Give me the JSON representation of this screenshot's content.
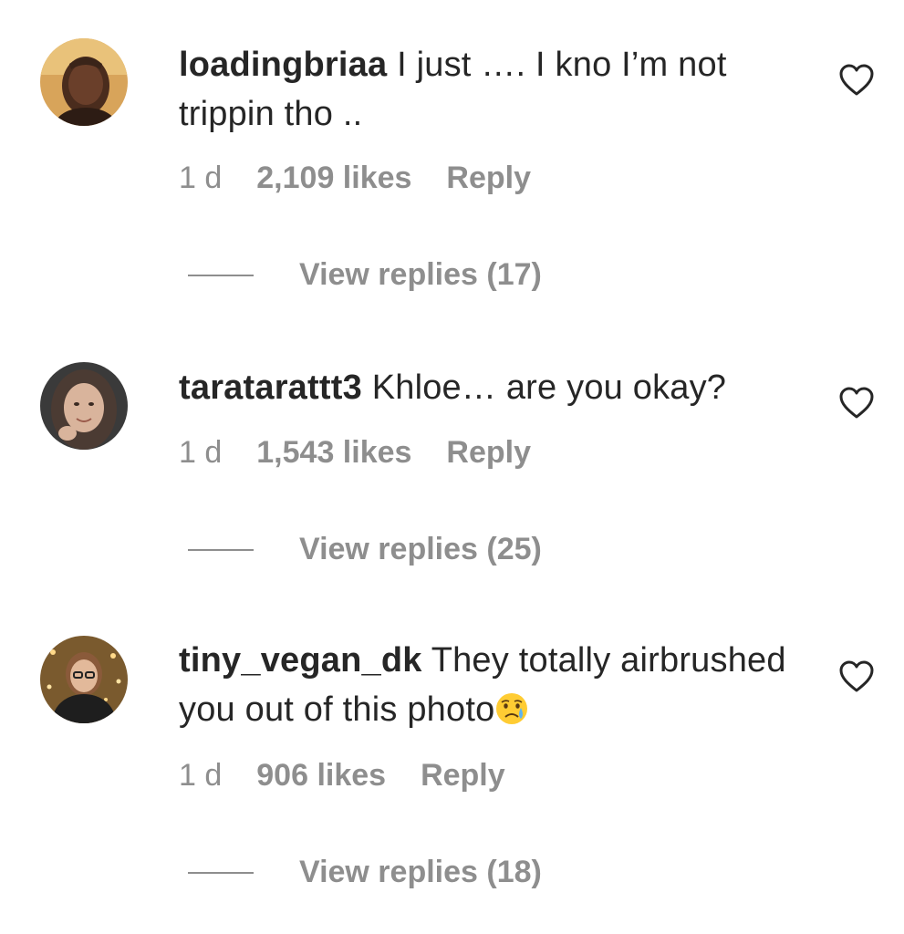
{
  "comments": [
    {
      "username": "loadingbriaa",
      "text": "I just …. I kno I’m not trippin tho ..",
      "time": "1 d",
      "likes": "2,109 likes",
      "reply_label": "Reply",
      "view_replies": "View replies (17)",
      "icon": "heart-outline-icon"
    },
    {
      "username": "taratarattt3",
      "text": "Khloe… are you okay?",
      "time": "1 d",
      "likes": "1,543 likes",
      "reply_label": "Reply",
      "view_replies": "View replies (25)",
      "icon": "heart-outline-icon"
    },
    {
      "username": "tiny_vegan_dk",
      "text": "They totally airbrushed you out of this photo",
      "emoji": "crying-face-emoji",
      "time": "1 d",
      "likes": "906 likes",
      "reply_label": "Reply",
      "view_replies": "View replies (18)",
      "icon": "heart-outline-icon"
    }
  ],
  "colors": {
    "text": "#262626",
    "secondary": "#8e8e8e",
    "background": "#ffffff"
  }
}
